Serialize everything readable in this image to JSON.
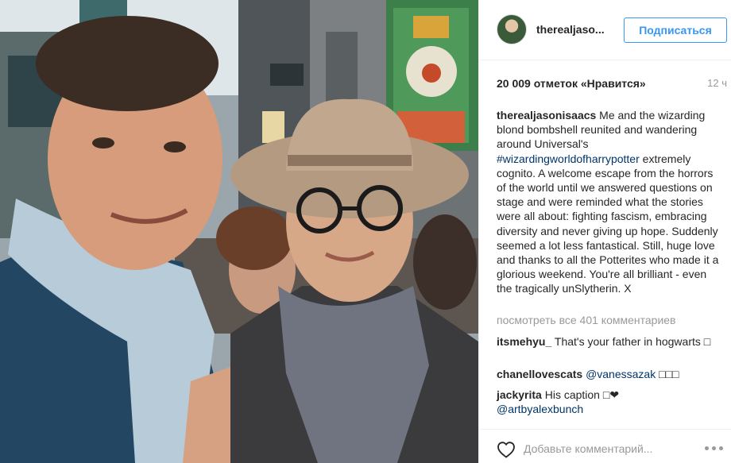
{
  "post": {
    "username": "therealjaso...",
    "follow_label": "Подписаться",
    "likes": "20 009 отметок «Нравится»",
    "time": "12 ч"
  },
  "caption": {
    "user": "therealjasonisaacs",
    "text_before": " Me and the wizarding blond bombshell reunited and wandering around Universal's ",
    "hashtag": "#wizardingworldofharrypotter",
    "text_after": " extremely cognito. A welcome escape from the horrors of the world until we answered questions on stage and were reminded what the stories were all about: fighting fascism, embracing diversity and never giving up hope. Suddenly seemed a lot less fantastical. Still, huge love and thanks to all the Potterites who made it a glorious weekend. You're all brilliant - even the tragically unSlytherin. X"
  },
  "view_all": "посмотреть все 401 комментариев",
  "comments": [
    {
      "user": "itsmehyu_",
      "text": " That's your father in hogwarts □"
    },
    {
      "user": "chanellovescats",
      "mention": "@vanessazak",
      "text": " □□□"
    },
    {
      "user": "jackyrita",
      "text": " His caption □❤",
      "mention": "@artbyalexbunch"
    }
  ],
  "add_comment": {
    "placeholder": "Добавьте комментарий..."
  },
  "icons": {
    "like": "heart-icon",
    "options": "more-options-icon",
    "avatar": "avatar"
  },
  "colors": {
    "link": "#003569",
    "follow": "#3897f0",
    "muted": "#999999"
  }
}
